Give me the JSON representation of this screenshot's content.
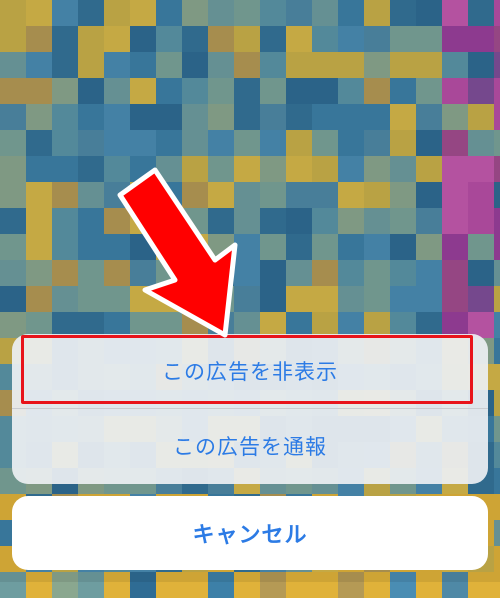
{
  "action_sheet": {
    "hide_ad_label": "この広告を非表示",
    "report_ad_label": "この広告を通報",
    "cancel_label": "キャンセル"
  },
  "colors": {
    "action_text": "#2c7be5",
    "highlight": "#e8141b",
    "arrow": "#ff0000"
  },
  "background": {
    "description_icon": "pixelated-mosaic-background"
  },
  "annotation": {
    "arrow_icon": "red-arrow-icon",
    "highlight_target": "hide-ad-button"
  }
}
